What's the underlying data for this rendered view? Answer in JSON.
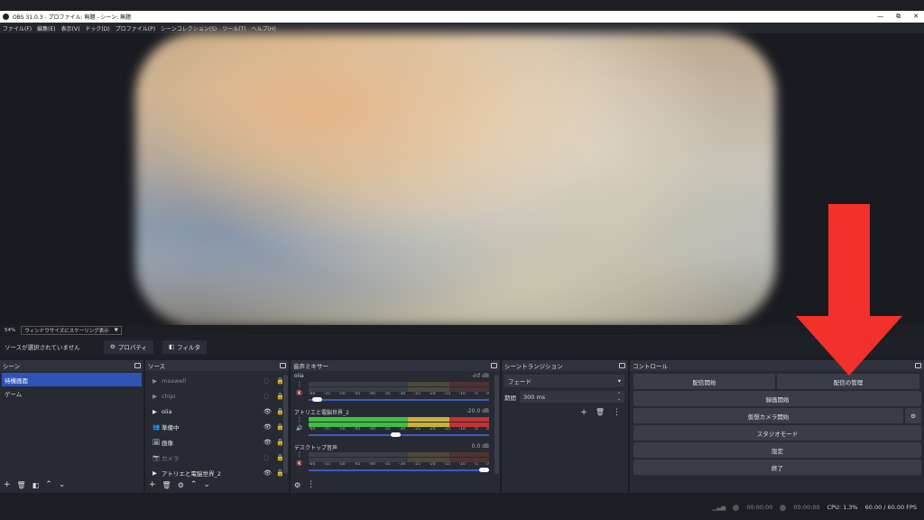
{
  "window": {
    "title": "OBS 31.0.3 - プロファイル: 無題 - シーン: 無題",
    "minimize": "—",
    "maximize": "⧉",
    "close": "✕"
  },
  "menu": [
    "ファイル(F)",
    "編集(E)",
    "表示(V)",
    "ドック(D)",
    "プロファイル(P)",
    "シーンコレクション(S)",
    "ツール(T)",
    "ヘルプ(H)"
  ],
  "preview": {
    "zoom": "54%",
    "scaling": "ウィンドウサイズにスケーリング表示"
  },
  "context": {
    "no_source": "ソースが選択されていません",
    "properties": "プロパティ",
    "filters": "フィルタ"
  },
  "scenes": {
    "title": "シーン",
    "items": [
      "待機画面",
      "ゲーム"
    ]
  },
  "sources": {
    "title": "ソース",
    "items": [
      {
        "icon": "▶",
        "name": "maxwell",
        "dim": true
      },
      {
        "icon": "▶",
        "name": "chipi",
        "dim": true
      },
      {
        "icon": "▶",
        "name": "oiia",
        "dim": false
      },
      {
        "icon": "👥",
        "name": "準備中",
        "dim": false
      },
      {
        "icon": "🖼",
        "name": "画像",
        "dim": false
      },
      {
        "icon": "📷",
        "name": "カメラ",
        "dim": true
      },
      {
        "icon": "▶",
        "name": "アトリエと電脳世界_2",
        "dim": false
      }
    ]
  },
  "mixer": {
    "title": "音声ミキサー",
    "ticks": [
      "-60",
      "-55",
      "-50",
      "-45",
      "-40",
      "-35",
      "-30",
      "-25",
      "-20",
      "-15",
      "-10",
      "-5",
      "0"
    ],
    "channels": [
      {
        "name": "oiia",
        "db": "-inf dB",
        "level": 0,
        "volume": 0.02
      },
      {
        "name": "アトリエと電脳世界_2",
        "db": "-20.0 dB",
        "level": 1,
        "volume": 0.48
      },
      {
        "name": "デスクトップ音声",
        "db": "0.0 dB",
        "level": 0,
        "volume": 1
      }
    ]
  },
  "transitions": {
    "title": "シーントランジション",
    "type": "フェード",
    "duration_label": "期間",
    "duration": "300 ms"
  },
  "controls": {
    "title": "コントロール",
    "start_stream": "配信開始",
    "manage_stream": "配信の管理",
    "start_record": "録画開始",
    "virtual_cam": "仮想カメラ開始",
    "studio": "スタジオモード",
    "settings": "設定",
    "exit": "終了"
  },
  "status": {
    "stream_time": "00:00:00",
    "rec_time": "00:00:00",
    "cpu": "CPU: 1.3%",
    "fps": "60.00 / 60.00 FPS"
  },
  "colors": {
    "arrow": "#f2302c",
    "accent": "#2f54b8"
  }
}
